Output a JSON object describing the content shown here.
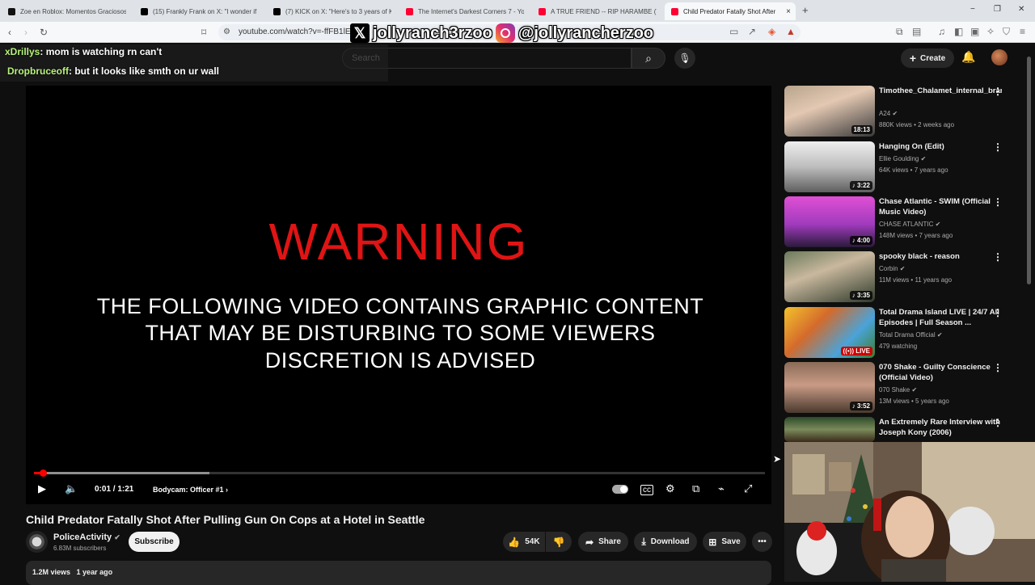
{
  "browser": {
    "tabs": [
      {
        "label": "Zoe en Roblox: Momentos Graciosos",
        "favicon_color": "#111111"
      },
      {
        "label": "(15) Frankly Frank on X: \"I wonder if i",
        "favicon_color": "#000000"
      },
      {
        "label": "(7) KICK on X: \"Here's to 3 years of K",
        "favicon_color": "#000000"
      },
      {
        "label": "The Internet's Darkest Corners 7 - Yo",
        "favicon_color": "#ff0033"
      },
      {
        "label": "A TRUE FRIEND -- RIP HARAMBE (TR",
        "favicon_color": "#ff0033"
      },
      {
        "label": "Child Predator Fatally Shot After",
        "favicon_color": "#ff0033",
        "active": true
      }
    ],
    "tab_close_glyph": "×",
    "new_tab_glyph": "+",
    "window_buttons": [
      "−",
      "❐",
      "✕"
    ],
    "url": "youtube.com/watch?v=-ffFB1lEfx"
  },
  "overlay": {
    "x_handle": "jollyranch3rzoo",
    "ig_handle": "@jollyrancherzoo",
    "chat": [
      {
        "user": "xDrillys",
        "message": ": mom is watching rn can't"
      },
      {
        "user": "Dropbruceoff",
        "message": ": but it looks like smth on ur wall"
      }
    ]
  },
  "youtube_header": {
    "search_placeholder": "Search",
    "create_label": "Create"
  },
  "video": {
    "warning_title": "WARNING",
    "warning_lines": [
      "THE FOLLOWING VIDEO CONTAINS GRAPHIC CONTENT",
      "THAT MAY BE DISTURBING TO SOME VIEWERS",
      "DISCRETION IS ADVISED"
    ],
    "time": "0:01 / 1:21",
    "chapter": "Bodycam: Officer #1",
    "played_fraction": 0.012,
    "buffered_fraction": 0.24
  },
  "details": {
    "title": "Child Predator Fatally Shot After Pulling Gun On Cops at a Hotel in Seattle",
    "channel": "PoliceActivity",
    "subscribers": "6.83M subscribers",
    "subscribe_label": "Subscribe",
    "likes": "54K",
    "share_label": "Share",
    "download_label": "Download",
    "save_label": "Save",
    "views": "1.2M views",
    "age": "1 year ago"
  },
  "recommendations": [
    {
      "title": "Timothee_Chalamet_internal_brand_marketing_meeting_Mart...",
      "channel": "A24",
      "verified": true,
      "meta": "880K views • 2 weeks ago",
      "duration": "18:13",
      "music": false,
      "live": false
    },
    {
      "title": "Hanging On (Edit)",
      "channel": "Ellie Goulding",
      "verified": true,
      "meta": "64K views • 7 years ago",
      "duration": "3:22",
      "music": true,
      "live": false
    },
    {
      "title": "Chase Atlantic - SWIM (Official Music Video)",
      "channel": "CHASE ATLANTIC",
      "verified": true,
      "meta": "148M views • 7 years ago",
      "duration": "4:00",
      "music": true,
      "live": false
    },
    {
      "title": "spooky black - reason",
      "channel": "Corbin",
      "verified": true,
      "meta": "11M views • 11 years ago",
      "duration": "3:35",
      "music": true,
      "live": false
    },
    {
      "title": "Total Drama Island LIVE | 24/7 All Episodes | Full Season ...",
      "channel": "Total Drama Official",
      "verified": true,
      "meta": "479 watching",
      "duration": "LIVE",
      "music": false,
      "live": true
    },
    {
      "title": "070 Shake - Guilty Conscience (Official Video)",
      "channel": "070 Shake",
      "verified": true,
      "meta": "13M views • 5 years ago",
      "duration": "3:52",
      "music": true,
      "live": false
    },
    {
      "title": "An Extremely Rare Interview with Joseph Kony (2006)",
      "channel": "",
      "verified": false,
      "meta": "",
      "duration": "",
      "music": false,
      "live": false
    }
  ],
  "colors": {
    "accent_red": "#ff0000",
    "warning_red": "#e01414",
    "yt_background": "#0f0f0f",
    "chat_user_green": "#b9f27c"
  }
}
